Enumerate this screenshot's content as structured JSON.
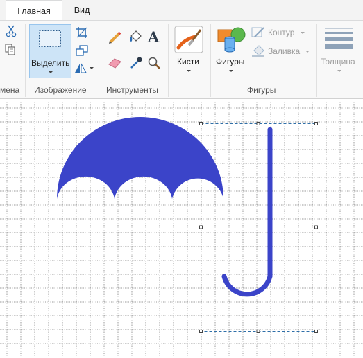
{
  "tabs": {
    "home": "Главная",
    "view": "Вид"
  },
  "ribbon": {
    "clipboard_label": "мена",
    "image": {
      "label": "Изображение",
      "select_label": "Выделить"
    },
    "tools_label": "Инструменты",
    "brushes_label": "Кисти",
    "shapes": {
      "label": "Фигуры",
      "button_label": "Фигуры",
      "outline_label": "Контур",
      "fill_label": "Заливка"
    },
    "thickness_label": "Толщина"
  },
  "canvas": {
    "grid": true,
    "drawing_color": "#3b44c9",
    "selection": "dashed rectangle around umbrella handle"
  },
  "colors": {
    "accent": "#cde4f7",
    "accent_border": "#98c5ed",
    "grid": "#9a9a9a",
    "shape": "#3b44c9"
  }
}
